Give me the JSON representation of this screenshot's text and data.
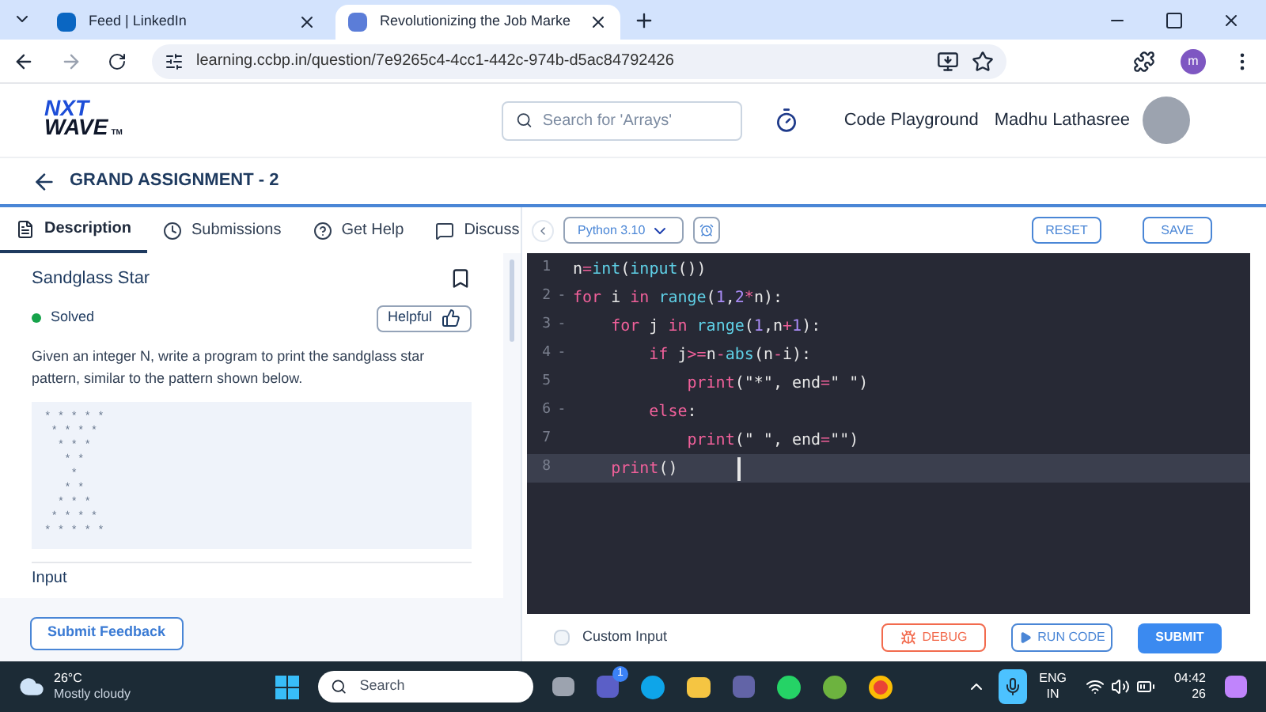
{
  "browser_tabs": [
    {
      "title": "Feed | LinkedIn",
      "selected": false
    },
    {
      "title": "Revolutionizing the Job Marke",
      "selected": true
    }
  ],
  "address_bar": {
    "url": "learning.ccbp.in/question/7e9265c4-4cc1-442c-974b-d5ac84792426",
    "profile_initial": "m"
  },
  "header": {
    "logo_top": "NXT",
    "logo_bottom": "WAVE",
    "logo_mark": "TM",
    "search": {
      "placeholder": "Search for 'Arrays'"
    },
    "playground": "Code Playground",
    "user": "Madhu Lathasree"
  },
  "assignment_title": "GRAND ASSIGNMENT - 2",
  "problem_tabs": [
    {
      "label": "Description",
      "kind": "description",
      "selected": true
    },
    {
      "label": "Submissions",
      "kind": "submissions",
      "selected": false
    },
    {
      "label": "Get Help",
      "kind": "help",
      "selected": false
    },
    {
      "label": "Discuss",
      "kind": "discuss",
      "selected": false
    }
  ],
  "problem": {
    "title": "Sandglass Star",
    "bookmarked": false,
    "status": "Solved",
    "helpful": "Helpful",
    "description": "Given an integer N, write a program to print the sandglass star pattern, similar to the pattern shown below.",
    "pattern": "* * * * *\n * * * *\n  * * *\n   * *\n    *\n   * *\n  * * *\n * * * *\n* * * * *",
    "next_heading": "Input"
  },
  "submit_feedback": "Submit Feedback",
  "editor": {
    "language": "Python 3.10",
    "reset": "RESET",
    "save": "SAVE",
    "lines": [
      {
        "number": "1",
        "current": false,
        "tokens": [
          {
            "kind": "plain",
            "text": "n"
          },
          {
            "kind": "op",
            "text": "="
          },
          {
            "kind": "func",
            "text": "int"
          },
          {
            "kind": "plain",
            "text": "("
          },
          {
            "kind": "func",
            "text": "input"
          },
          {
            "kind": "plain",
            "text": "())"
          }
        ]
      },
      {
        "number": "2",
        "fold_marker": "-",
        "current": false,
        "tokens": [
          {
            "kind": "keyword",
            "text": "for"
          },
          {
            "kind": "plain",
            "text": " i "
          },
          {
            "kind": "keyword",
            "text": "in"
          },
          {
            "kind": "func",
            "text": " range"
          },
          {
            "kind": "plain",
            "text": "("
          },
          {
            "kind": "number",
            "text": "1"
          },
          {
            "kind": "plain",
            "text": ","
          },
          {
            "kind": "number",
            "text": "2"
          },
          {
            "kind": "op",
            "text": "*"
          },
          {
            "kind": "plain",
            "text": "n):"
          }
        ]
      },
      {
        "number": "3",
        "fold_marker": "-",
        "current": false,
        "tokens": [
          {
            "kind": "keyword",
            "text": "    for"
          },
          {
            "kind": "plain",
            "text": " j "
          },
          {
            "kind": "keyword",
            "text": "in"
          },
          {
            "kind": "func",
            "text": " range"
          },
          {
            "kind": "plain",
            "text": "("
          },
          {
            "kind": "number",
            "text": "1"
          },
          {
            "kind": "plain",
            "text": ",n"
          },
          {
            "kind": "op",
            "text": "+"
          },
          {
            "kind": "number",
            "text": "1"
          },
          {
            "kind": "plain",
            "text": "):"
          }
        ]
      },
      {
        "number": "4",
        "fold_marker": "-",
        "current": false,
        "tokens": [
          {
            "kind": "keyword",
            "text": "        if"
          },
          {
            "kind": "plain",
            "text": " j"
          },
          {
            "kind": "op",
            "text": ">="
          },
          {
            "kind": "plain",
            "text": "n"
          },
          {
            "kind": "op",
            "text": "-"
          },
          {
            "kind": "func",
            "text": "abs"
          },
          {
            "kind": "plain",
            "text": "(n"
          },
          {
            "kind": "op",
            "text": "-"
          },
          {
            "kind": "plain",
            "text": "i):"
          }
        ]
      },
      {
        "number": "5",
        "current": false,
        "tokens": [
          {
            "kind": "keyword",
            "text": "            print"
          },
          {
            "kind": "plain",
            "text": "(\"*\", end"
          },
          {
            "kind": "op",
            "text": "="
          },
          {
            "kind": "plain",
            "text": "\" \")"
          }
        ]
      },
      {
        "number": "6",
        "fold_marker": "-",
        "current": false,
        "tokens": [
          {
            "kind": "keyword",
            "text": "        else"
          },
          {
            "kind": "plain",
            "text": ":"
          }
        ]
      },
      {
        "number": "7",
        "current": false,
        "tokens": [
          {
            "kind": "keyword",
            "text": "            print"
          },
          {
            "kind": "plain",
            "text": "(\" \", end"
          },
          {
            "kind": "op",
            "text": "="
          },
          {
            "kind": "plain",
            "text": "\"\")"
          }
        ]
      },
      {
        "number": "8",
        "current": true,
        "tokens": [
          {
            "kind": "keyword",
            "text": "    print"
          },
          {
            "kind": "plain",
            "text": "()"
          }
        ]
      }
    ],
    "custom_input": {
      "label": "Custom Input",
      "checked": false
    },
    "debug": "DEBUG",
    "run": "RUN CODE",
    "submit": "SUBMIT"
  },
  "taskbar": {
    "temperature": "26°C",
    "weather": "Mostly cloudy",
    "search": {
      "placeholder": "Search"
    },
    "teams_badge": "1",
    "language": "ENG",
    "region": "IN",
    "time": "04:42",
    "date": "26"
  }
}
